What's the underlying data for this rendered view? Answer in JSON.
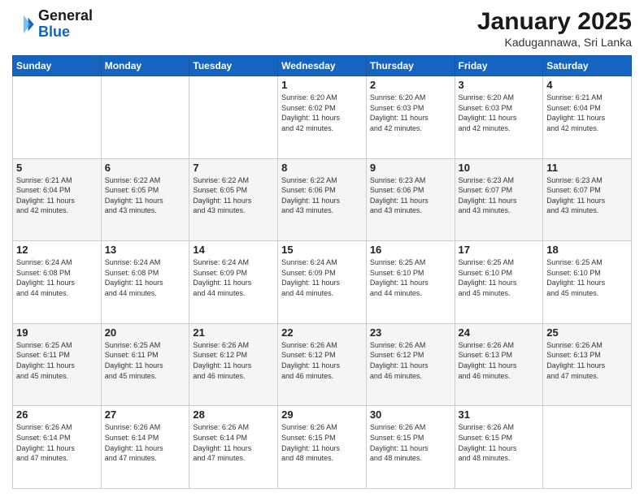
{
  "header": {
    "logo_general": "General",
    "logo_blue": "Blue",
    "month_title": "January 2025",
    "location": "Kadugannawa, Sri Lanka"
  },
  "weekdays": [
    "Sunday",
    "Monday",
    "Tuesday",
    "Wednesday",
    "Thursday",
    "Friday",
    "Saturday"
  ],
  "weeks": [
    [
      {
        "day": "",
        "info": ""
      },
      {
        "day": "",
        "info": ""
      },
      {
        "day": "",
        "info": ""
      },
      {
        "day": "1",
        "info": "Sunrise: 6:20 AM\nSunset: 6:02 PM\nDaylight: 11 hours\nand 42 minutes."
      },
      {
        "day": "2",
        "info": "Sunrise: 6:20 AM\nSunset: 6:03 PM\nDaylight: 11 hours\nand 42 minutes."
      },
      {
        "day": "3",
        "info": "Sunrise: 6:20 AM\nSunset: 6:03 PM\nDaylight: 11 hours\nand 42 minutes."
      },
      {
        "day": "4",
        "info": "Sunrise: 6:21 AM\nSunset: 6:04 PM\nDaylight: 11 hours\nand 42 minutes."
      }
    ],
    [
      {
        "day": "5",
        "info": "Sunrise: 6:21 AM\nSunset: 6:04 PM\nDaylight: 11 hours\nand 42 minutes."
      },
      {
        "day": "6",
        "info": "Sunrise: 6:22 AM\nSunset: 6:05 PM\nDaylight: 11 hours\nand 43 minutes."
      },
      {
        "day": "7",
        "info": "Sunrise: 6:22 AM\nSunset: 6:05 PM\nDaylight: 11 hours\nand 43 minutes."
      },
      {
        "day": "8",
        "info": "Sunrise: 6:22 AM\nSunset: 6:06 PM\nDaylight: 11 hours\nand 43 minutes."
      },
      {
        "day": "9",
        "info": "Sunrise: 6:23 AM\nSunset: 6:06 PM\nDaylight: 11 hours\nand 43 minutes."
      },
      {
        "day": "10",
        "info": "Sunrise: 6:23 AM\nSunset: 6:07 PM\nDaylight: 11 hours\nand 43 minutes."
      },
      {
        "day": "11",
        "info": "Sunrise: 6:23 AM\nSunset: 6:07 PM\nDaylight: 11 hours\nand 43 minutes."
      }
    ],
    [
      {
        "day": "12",
        "info": "Sunrise: 6:24 AM\nSunset: 6:08 PM\nDaylight: 11 hours\nand 44 minutes."
      },
      {
        "day": "13",
        "info": "Sunrise: 6:24 AM\nSunset: 6:08 PM\nDaylight: 11 hours\nand 44 minutes."
      },
      {
        "day": "14",
        "info": "Sunrise: 6:24 AM\nSunset: 6:09 PM\nDaylight: 11 hours\nand 44 minutes."
      },
      {
        "day": "15",
        "info": "Sunrise: 6:24 AM\nSunset: 6:09 PM\nDaylight: 11 hours\nand 44 minutes."
      },
      {
        "day": "16",
        "info": "Sunrise: 6:25 AM\nSunset: 6:10 PM\nDaylight: 11 hours\nand 44 minutes."
      },
      {
        "day": "17",
        "info": "Sunrise: 6:25 AM\nSunset: 6:10 PM\nDaylight: 11 hours\nand 45 minutes."
      },
      {
        "day": "18",
        "info": "Sunrise: 6:25 AM\nSunset: 6:10 PM\nDaylight: 11 hours\nand 45 minutes."
      }
    ],
    [
      {
        "day": "19",
        "info": "Sunrise: 6:25 AM\nSunset: 6:11 PM\nDaylight: 11 hours\nand 45 minutes."
      },
      {
        "day": "20",
        "info": "Sunrise: 6:25 AM\nSunset: 6:11 PM\nDaylight: 11 hours\nand 45 minutes."
      },
      {
        "day": "21",
        "info": "Sunrise: 6:26 AM\nSunset: 6:12 PM\nDaylight: 11 hours\nand 46 minutes."
      },
      {
        "day": "22",
        "info": "Sunrise: 6:26 AM\nSunset: 6:12 PM\nDaylight: 11 hours\nand 46 minutes."
      },
      {
        "day": "23",
        "info": "Sunrise: 6:26 AM\nSunset: 6:12 PM\nDaylight: 11 hours\nand 46 minutes."
      },
      {
        "day": "24",
        "info": "Sunrise: 6:26 AM\nSunset: 6:13 PM\nDaylight: 11 hours\nand 46 minutes."
      },
      {
        "day": "25",
        "info": "Sunrise: 6:26 AM\nSunset: 6:13 PM\nDaylight: 11 hours\nand 47 minutes."
      }
    ],
    [
      {
        "day": "26",
        "info": "Sunrise: 6:26 AM\nSunset: 6:14 PM\nDaylight: 11 hours\nand 47 minutes."
      },
      {
        "day": "27",
        "info": "Sunrise: 6:26 AM\nSunset: 6:14 PM\nDaylight: 11 hours\nand 47 minutes."
      },
      {
        "day": "28",
        "info": "Sunrise: 6:26 AM\nSunset: 6:14 PM\nDaylight: 11 hours\nand 47 minutes."
      },
      {
        "day": "29",
        "info": "Sunrise: 6:26 AM\nSunset: 6:15 PM\nDaylight: 11 hours\nand 48 minutes."
      },
      {
        "day": "30",
        "info": "Sunrise: 6:26 AM\nSunset: 6:15 PM\nDaylight: 11 hours\nand 48 minutes."
      },
      {
        "day": "31",
        "info": "Sunrise: 6:26 AM\nSunset: 6:15 PM\nDaylight: 11 hours\nand 48 minutes."
      },
      {
        "day": "",
        "info": ""
      }
    ]
  ]
}
